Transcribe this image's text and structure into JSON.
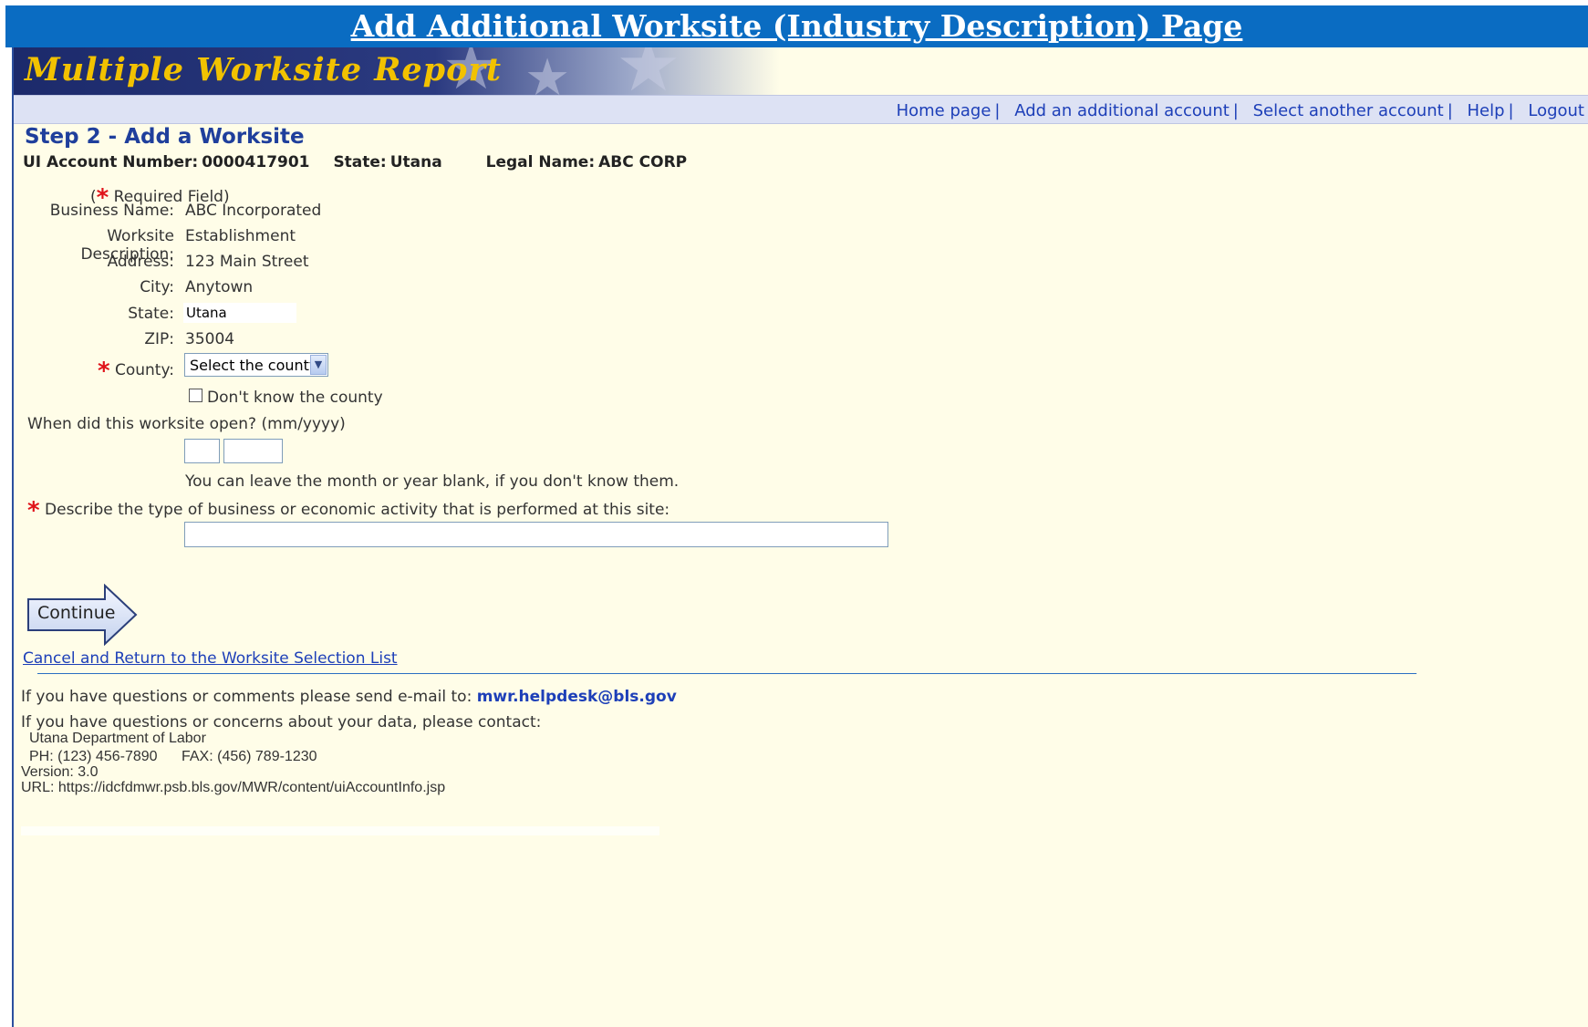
{
  "page_title": "Add Additional Worksite (Industry Description) Page",
  "banner": {
    "title": "Multiple Worksite Report"
  },
  "nav": [
    {
      "label": "Home page"
    },
    {
      "label": "Add an additional account"
    },
    {
      "label": "Select another account"
    },
    {
      "label": "Help"
    },
    {
      "label": "Logout"
    }
  ],
  "nav_separator": "|",
  "step": {
    "title": "Step 2 - Add a Worksite"
  },
  "account": {
    "ui_label": "UI Account Number:",
    "ui_value": "0000417901",
    "state_label": "State:",
    "state_value": "Utana",
    "legal_label": "Legal Name:",
    "legal_value": "ABC CORP"
  },
  "required_note": {
    "open": "(",
    "star": "*",
    "text": " Required Field)"
  },
  "form": {
    "business_name": {
      "label": "Business Name:",
      "value": "ABC Incorporated"
    },
    "worksite_description": {
      "label": "Worksite Description:",
      "value": "Establishment"
    },
    "address": {
      "label": "Address:",
      "value": "123 Main Street"
    },
    "city": {
      "label": "City:",
      "value": "Anytown"
    },
    "state": {
      "label": "State:",
      "value": "Utana"
    },
    "zip": {
      "label": "ZIP:",
      "value": "35004"
    },
    "county": {
      "label": "County:",
      "selected": "Select the county"
    },
    "dont_know_county": {
      "label": "Don't know the county"
    },
    "open_date": {
      "label": "When did this worksite open? (mm/yyyy)",
      "hint": "You can leave the month or year blank, if you don't know them."
    },
    "business_activity": {
      "label": "Describe the type of business or economic activity that is performed at this site:"
    }
  },
  "continue_label": "Continue",
  "cancel_link": "Cancel and Return to the Worksite Selection List",
  "footer": {
    "questions_text": "If you have questions or comments please send e-mail to:",
    "email": "mwr.helpdesk@bls.gov",
    "concerns_text": "If you have questions or concerns about your data, please contact:",
    "dept": "Utana Department of  Labor",
    "phone": "PH: (123) 456-7890",
    "fax": "FAX: (456) 789-1230",
    "version": "Version: 3.0",
    "url": "URL: https://idcfdmwr.psb.bls.gov/MWR/content/uiAccountInfo.jsp"
  },
  "colors": {
    "title_bar": "#0a6cc2",
    "page_bg": "#fffde8",
    "link": "#1d3fb8",
    "required": "#e0141a",
    "banner_text": "#f2c200"
  }
}
